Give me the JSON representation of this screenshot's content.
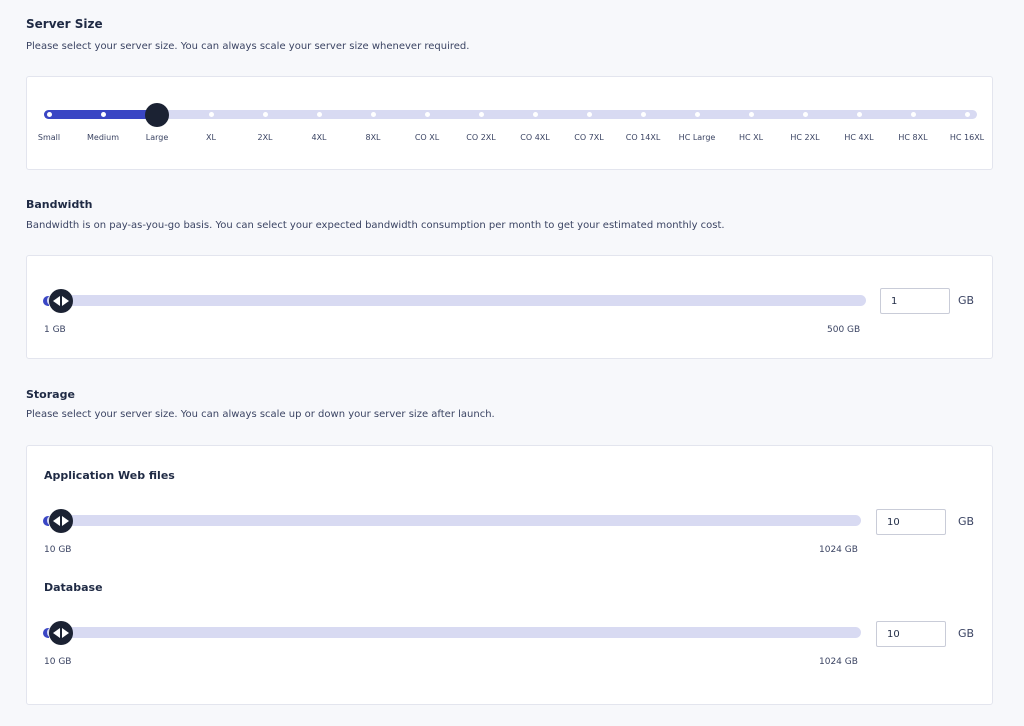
{
  "server_size": {
    "title": "Server Size",
    "description": "Please select your server size. You can always scale your server size whenever required.",
    "options": [
      "Small",
      "Medium",
      "Large",
      "XL",
      "2XL",
      "4XL",
      "8XL",
      "CO XL",
      "CO 2XL",
      "CO 4XL",
      "CO 7XL",
      "CO 14XL",
      "HC Large",
      "HC XL",
      "HC 2XL",
      "HC 4XL",
      "HC 8XL",
      "HC 16XL"
    ],
    "selected": "Large",
    "selected_index": 2
  },
  "bandwidth": {
    "title": "Bandwidth",
    "description": "Bandwidth is on pay-as-you-go basis. You can select your expected bandwidth consumption per month to get your estimated monthly cost.",
    "min_label": "1 GB",
    "max_label": "500 GB",
    "value": "1",
    "unit": "GB"
  },
  "storage": {
    "title": "Storage",
    "description": "Please select your server size. You can always scale up or down your server size after launch.",
    "web_files": {
      "title": "Application Web files",
      "min_label": "10 GB",
      "max_label": "1024 GB",
      "value": "10",
      "unit": "GB"
    },
    "database": {
      "title": "Database",
      "min_label": "10 GB",
      "max_label": "1024 GB",
      "value": "10",
      "unit": "GB"
    }
  },
  "colors": {
    "accent": "#3a46c4",
    "track": "#d8daf2",
    "knob": "#1b2233"
  },
  "icons": {
    "range_handle": "double-arrow-handle-icon"
  }
}
